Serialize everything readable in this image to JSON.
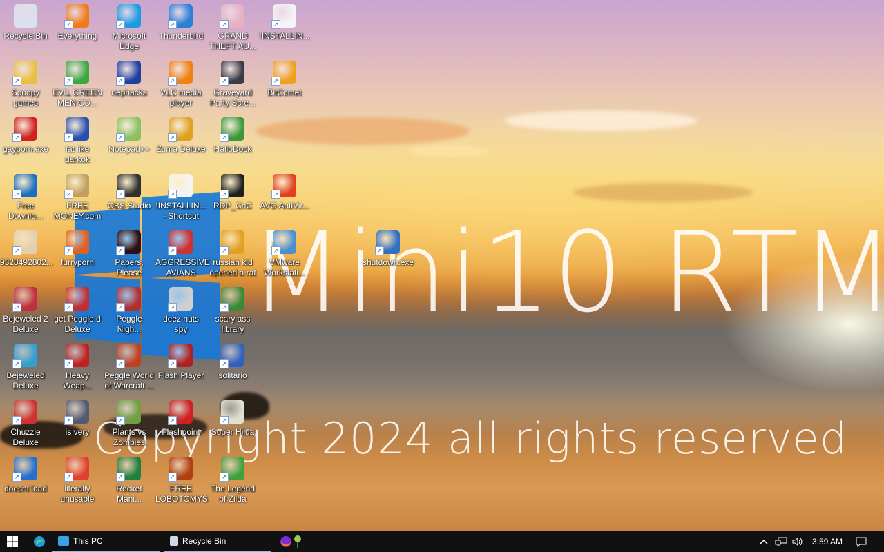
{
  "desktop": {
    "overlay": {
      "title": "Mini10 RTM",
      "copyright": "Copyright 2024 all rights reserved"
    },
    "icons": [
      {
        "label": "Recycle Bin",
        "icon": "recycle-bin-icon",
        "color": "#d8e2ee"
      },
      {
        "label": "Everything",
        "icon": "everything-icon",
        "color": "#f07a1a"
      },
      {
        "label": "Microsoft Edge",
        "icon": "edge-icon",
        "color": "#1e9be0"
      },
      {
        "label": "Thunderbird",
        "icon": "thunderbird-icon",
        "color": "#2b7fd6"
      },
      {
        "label": "GRAND THEFT AU...",
        "icon": "gta-icon",
        "color": "#e7b0c0"
      },
      {
        "label": "!INSTALLIN...",
        "icon": "text-file-icon",
        "color": "#f4f4f4"
      },
      {
        "label": "Spoopy games",
        "icon": "folder-icon",
        "color": "#e8c040"
      },
      {
        "label": "EVIL GREEN MEN CO...",
        "icon": "green-men-icon",
        "color": "#3aa940"
      },
      {
        "label": "nephacks",
        "icon": "nephacks-icon",
        "color": "#2040a0"
      },
      {
        "label": "VLC media player",
        "icon": "vlc-icon",
        "color": "#f08010"
      },
      {
        "label": "Graveyard Party Scre...",
        "icon": "graveyard-icon",
        "color": "#3b3b45"
      },
      {
        "label": "BitComet",
        "icon": "bitcomet-icon",
        "color": "#f0a020"
      },
      {
        "label": "gayporn.exe",
        "icon": "flash-icon",
        "color": "#d02020"
      },
      {
        "label": "fat like darkok",
        "icon": "game-icon",
        "color": "#2850b0"
      },
      {
        "label": "Notepad++",
        "icon": "notepadpp-icon",
        "color": "#8cc060"
      },
      {
        "label": "Zuma Deluxe",
        "icon": "zuma-icon",
        "color": "#e0a020"
      },
      {
        "label": "HalloDock",
        "icon": "shield-icon",
        "color": "#3a9a3a"
      },
      {
        "label": "Free Downlo...",
        "icon": "download-icon",
        "color": "#1a70c0"
      },
      {
        "label": "FREE MONEY.com",
        "icon": "money-icon",
        "color": "#c0a060"
      },
      {
        "label": "OBS Studio",
        "icon": "obs-icon",
        "color": "#303030"
      },
      {
        "label": "!INSTALLIN... - Shortcut",
        "icon": "text-file-icon",
        "color": "#f4f4f4"
      },
      {
        "label": "RDP_CnC",
        "icon": "rdp-icon",
        "color": "#202020"
      },
      {
        "label": "AVG AntiVir...",
        "icon": "avg-icon",
        "color": "#e04020"
      },
      {
        "label": "9328492802...",
        "icon": "image-file-icon",
        "color": "#e0d0b0"
      },
      {
        "label": "furryporn",
        "icon": "firefox-icon",
        "color": "#e06020"
      },
      {
        "label": "Papers, Please",
        "icon": "papers-please-icon",
        "color": "#301010"
      },
      {
        "label": "AGGRESSIVE AVIANS",
        "icon": "angry-birds-icon",
        "color": "#d03030"
      },
      {
        "label": "russian kid opened a rat",
        "icon": "rat-icon",
        "color": "#e0a020"
      },
      {
        "label": "VMware Workstati...",
        "icon": "vmware-icon",
        "color": "#4a90d0"
      },
      {
        "label": "shutdown.exe",
        "icon": "shutdown-icon",
        "color": "#3070c0"
      },
      {
        "label": "Bejeweled 2 Deluxe",
        "icon": "bejeweled-icon",
        "color": "#c03040"
      },
      {
        "label": "get Peggle d Deluxe",
        "icon": "peggle-icon",
        "color": "#c03030"
      },
      {
        "label": "Peggle Nigh...",
        "icon": "peggle-icon",
        "color": "#b03030"
      },
      {
        "label": "deez nuts spy",
        "icon": "windows-icon",
        "color": "#d0d0d0"
      },
      {
        "label": "scary ass library",
        "icon": "library-icon",
        "color": "#3a8a3a"
      },
      {
        "label": "Bejeweled Deluxe",
        "icon": "bejeweled-icon",
        "color": "#30a0d0"
      },
      {
        "label": "Heavy Weap...",
        "icon": "heavy-weapon-icon",
        "color": "#c02020"
      },
      {
        "label": "Peggle World of Warcraft ...",
        "icon": "peggle-icon",
        "color": "#c04020"
      },
      {
        "label": "Flash Player",
        "icon": "flash-icon",
        "color": "#b02020"
      },
      {
        "label": "solitario",
        "icon": "solitaire-icon",
        "color": "#3060c0"
      },
      {
        "label": "Chuzzle Deluxe",
        "icon": "chuzzle-icon",
        "color": "#d03030"
      },
      {
        "label": "is very",
        "icon": "shield-icon",
        "color": "#505a70"
      },
      {
        "label": "Plants vs Zombies",
        "icon": "pvz-icon",
        "color": "#70a040"
      },
      {
        "label": "Flashpoint",
        "icon": "flashpoint-icon",
        "color": "#d02020"
      },
      {
        "label": "Super Hilda",
        "icon": "super-hilda-icon",
        "color": "#e0e0d0"
      },
      {
        "label": "doesnt load",
        "icon": "edge-icon",
        "color": "#2070d0"
      },
      {
        "label": "literally unusable",
        "icon": "chrome-icon",
        "color": "#e04030"
      },
      {
        "label": "Rocket Mani...",
        "icon": "rocket-mania-icon",
        "color": "#208040"
      },
      {
        "label": "FREE LOBOTOMYS",
        "icon": "lobotomy-icon",
        "color": "#b04010"
      },
      {
        "label": "The Legend of Zilda",
        "icon": "zelda-icon",
        "color": "#40a040"
      }
    ]
  },
  "taskbar": {
    "start": "windows-start-icon",
    "pinned_edge": "edge-icon",
    "tasks": [
      {
        "label": "This PC",
        "icon": "computer-icon"
      },
      {
        "label": "Recycle Bin",
        "icon": "recycle-bin-icon"
      }
    ],
    "tray_apps": [
      "firefox-icon",
      "pvz-icon"
    ],
    "clock": "3:59 AM",
    "colors": {
      "bar": "#111111",
      "accent": "#9ab8e8"
    }
  }
}
